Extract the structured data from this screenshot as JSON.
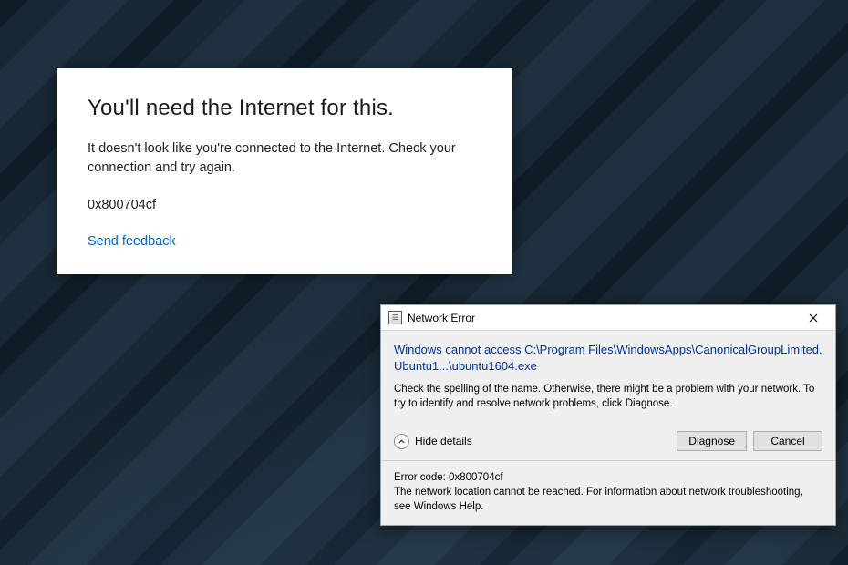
{
  "card": {
    "title": "You'll need the Internet for this.",
    "body": "It doesn't look like you're connected to the Internet. Check your connection and try again.",
    "error_code": "0x800704cf",
    "feedback_link": "Send feedback"
  },
  "dialog": {
    "title": "Network Error",
    "headline": "Windows cannot access C:\\Program Files\\WindowsApps\\CanonicalGroupLimited.Ubuntu1...\\ubuntu1604.exe",
    "instruction": "Check the spelling of the name. Otherwise, there might be a problem with your network. To try to identify and resolve network problems, click Diagnose.",
    "toggle_label": "Hide details",
    "buttons": {
      "diagnose": "Diagnose",
      "cancel": "Cancel"
    },
    "details": {
      "error_line": "Error code: 0x800704cf",
      "description": "The network location cannot be reached. For information about network troubleshooting, see Windows Help."
    }
  }
}
